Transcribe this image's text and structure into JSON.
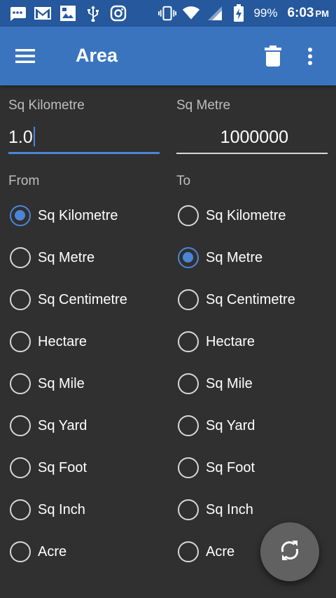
{
  "status_bar": {
    "battery": "99%",
    "time": "6:03",
    "ampm": "PM",
    "icons": [
      "message-icon",
      "gmail-icon",
      "gallery-icon",
      "usb-icon",
      "instagram-icon",
      "vibrate-icon",
      "wifi-icon",
      "signal-icon",
      "battery-charging-icon"
    ]
  },
  "app_bar": {
    "title": "Area",
    "menu_icon": "hamburger-menu-icon",
    "delete_icon": "trash-icon",
    "more_icon": "more-vert-icon"
  },
  "from_panel": {
    "unit_label": "Sq Kilometre",
    "input_value": "1.0",
    "section_label": "From",
    "selected": "Sq Kilometre"
  },
  "to_panel": {
    "unit_label": "Sq Metre",
    "input_value": "1000000",
    "section_label": "To",
    "selected": "Sq Metre"
  },
  "units": [
    "Sq Kilometre",
    "Sq Metre",
    "Sq Centimetre",
    "Hectare",
    "Sq Mile",
    "Sq Yard",
    "Sq Foot",
    "Sq Inch",
    "Acre"
  ],
  "fab": {
    "icon": "swap-refresh-icon"
  },
  "colors": {
    "status_bar": "#25589c",
    "app_bar": "#3a74bf",
    "background": "#303030",
    "accent": "#4a86d8",
    "fab": "#616161"
  }
}
